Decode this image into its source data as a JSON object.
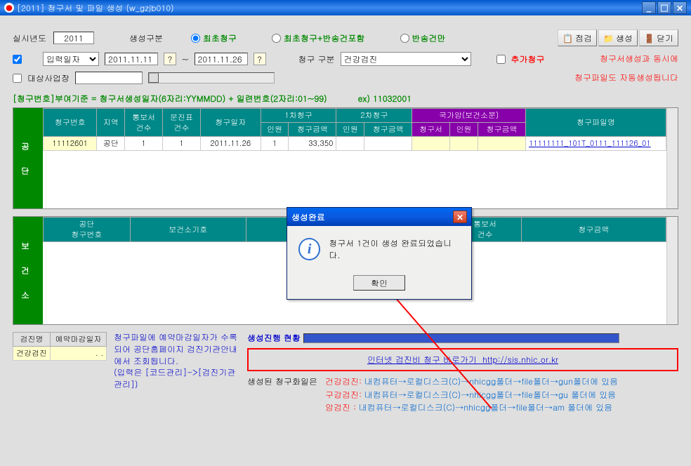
{
  "window": {
    "title": "[2011] 청구서 및 파일 생성 (w_gzjb010)"
  },
  "toolbar": {
    "year_label": "실시년도",
    "year_value": "2011",
    "gen_type_label": "생성구분",
    "radio1": "최초청구",
    "radio2": "최초청구+반송건포함",
    "radio3": "반송건만",
    "btn_check": "점검",
    "btn_gen": "생성",
    "btn_close": "닫기"
  },
  "filter": {
    "date_type": "입력일자",
    "date_from": "2011.11.11",
    "date_to": "2011.11.26",
    "cg_type_label": "청구 구분",
    "cg_type_value": "건강검진",
    "add_label": "추가청구",
    "target_label": "대상사업장"
  },
  "info": {
    "line1": "청구서생성과 동시에",
    "line2": "청구파일도 자동생성됩니다"
  },
  "formula": {
    "text": "[청구번호]부여기준 = 청구서생성일자(6자리:YYMMDD) + 일련번호(2자리:01~99)",
    "example": "ex) 11032001"
  },
  "table1": {
    "side": "공단",
    "headers": {
      "no": "청구번호",
      "area": "지역",
      "tb": "통보서\n건수",
      "mj": "문진표\n건수",
      "date": "청구일자",
      "g1": "1차청구",
      "g2": "2차청구",
      "g3": "국가암(보건소분)",
      "inwon": "인원",
      "amount": "청구금액",
      "cg": "청구서",
      "file": "청구파일명"
    },
    "row": {
      "no": "11112601",
      "area": "공단",
      "tb": "1",
      "mj": "1",
      "date": "2011.11.26",
      "inwon1": "1",
      "amount1": "33,350",
      "inwon2": "",
      "amount2": "",
      "cg3": "",
      "inwon3": "",
      "amount3": "",
      "file": "11111111_101T_0111_111126_01"
    }
  },
  "table2": {
    "side": "보건소",
    "headers": {
      "h1": "공단\n청구번호",
      "h2": "보건소기호",
      "h3": "",
      "h4": "",
      "h5": "통보서\n건수",
      "h6": "청구금액"
    }
  },
  "bottom_table": {
    "h1": "검진명",
    "h2": "예약마감일자",
    "r1c1": "건강검진",
    "r1c2": ". ."
  },
  "note": "청구파일에 예약마감일자가 수록되어 공단홈페이지 검진기관안내에서 조회됩니다.\n(입력은 [코드관리]->[검진기관관리])",
  "progress": {
    "label": "생성진행 현황"
  },
  "link": {
    "text": "인터넷 검진비 청구 바로가기",
    "url": "http://sis.nhic.or.kr"
  },
  "paths": {
    "label": "생성된 청구화일은",
    "p1k": "건강검진:",
    "p1v": "내컴퓨터→로컬디스크(C)→nhicgg폴더→file폴더→gun폴더에 있음",
    "p2k": "구강검진:",
    "p2v": "내컴퓨터→로컬디스크(C)→nhicgg폴더→file폴더→gu 폴더에 있음",
    "p3k": "암검진 :",
    "p3v": "내컴퓨터→로컬디스크(C)→nhicgg폴더→file폴더→am 폴더에 있음"
  },
  "dialog": {
    "title": "생성완료",
    "message": "청구서 1건이 생성 완료되었습니다.",
    "ok": "확인"
  }
}
